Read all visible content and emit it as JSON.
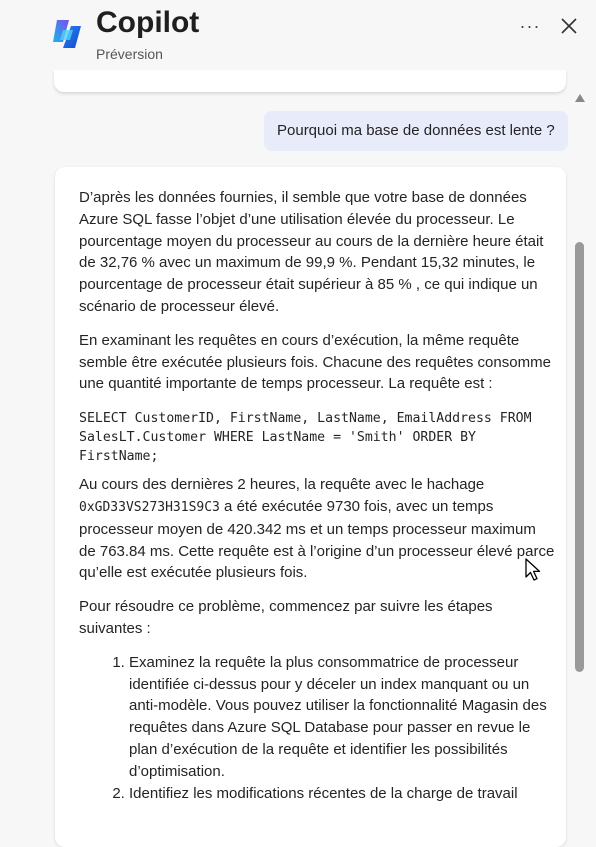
{
  "header": {
    "title": "Copilot",
    "subtitle": "Préversion",
    "more_label": "···",
    "logo_icon": "copilot-logo-icon",
    "close_icon": "close-icon"
  },
  "conversation": {
    "user_message": "Pourquoi ma base de données est lente ?",
    "reply": {
      "p1": "D’après les données fournies, il semble que votre base de données Azure SQL fasse l’objet d’une utilisation élevée du processeur. Le pourcentage moyen du processeur au cours de la dernière heure était de 32,76 % avec un maximum de 99,9 %. Pendant 15,32 minutes, le pourcentage de processeur était supérieur à 85 % , ce qui indique un scénario de processeur élevé.",
      "p2": "En examinant les requêtes en cours d’exécution, la même requête semble être exécutée plusieurs fois. Chacune des requêtes consomme une quantité importante de temps processeur. La requête est :",
      "code": "SELECT CustomerID, FirstName, LastName, EmailAddress FROM SalesLT.Customer WHERE LastName = 'Smith' ORDER BY FirstName;",
      "p3_a": "Au cours des dernières 2 heures, la requête avec le hachage ",
      "p3_hash": "0xGD33VS273H31S9C3",
      "p3_b": " a été exécutée 9730 fois, avec un temps processeur moyen de 420.342 ms et un temps processeur maximum de 763.84 ms. Cette requête est à l’origine d’un processeur élevé parce qu’elle est exécutée plusieurs fois.",
      "p4": "Pour résoudre ce problème, commencez par suivre les étapes suivantes :",
      "steps": [
        "Examinez la requête la plus consommatrice de processeur identifiée ci-dessus pour y déceler un index manquant ou un anti-modèle. Vous pouvez utiliser la fonctionnalité Magasin des requêtes dans Azure SQL Database pour passer en revue le plan d’exécution de la requête et identifier les possibilités d’optimisation.",
        "Identifiez les modifications récentes de la charge de travail"
      ]
    }
  },
  "colors": {
    "background": "#f7f7f7",
    "user_bubble": "#e8ebfa",
    "card": "#ffffff"
  }
}
